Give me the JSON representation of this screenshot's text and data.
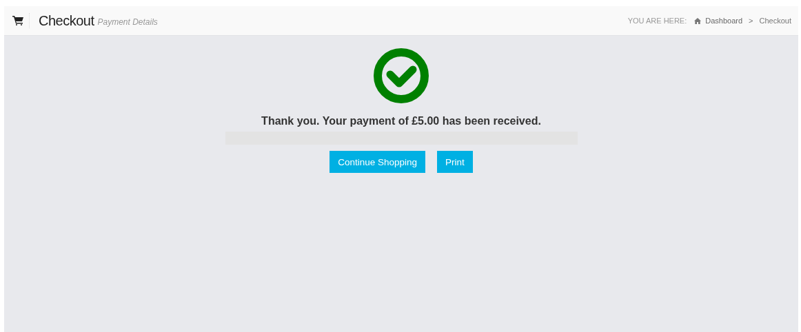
{
  "header": {
    "title": "Checkout",
    "subtitle": "Payment Details"
  },
  "breadcrumb": {
    "label": "YOU ARE HERE:",
    "items": [
      {
        "text": "Dashboard",
        "kind": "home"
      },
      {
        "text": "Checkout",
        "kind": "current"
      }
    ],
    "separator": ">"
  },
  "message": "Thank you. Your payment of £5.00 has been received.",
  "buttons": [
    "Continue Shopping",
    "Print"
  ]
}
